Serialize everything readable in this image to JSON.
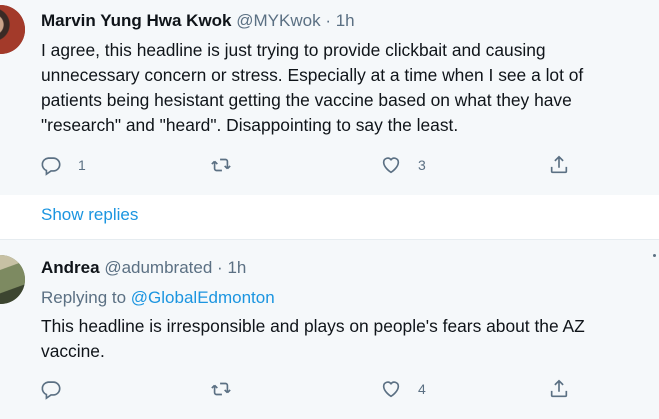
{
  "tweets": [
    {
      "name": "Marvin Yung Hwa Kwok",
      "handle": "@MYKwok",
      "dot": "·",
      "time": "1h",
      "text": "I agree, this headline is just trying to provide clickbait and causing unnecessary concern or stress. Especially at a time when I see a lot of patients being hesistant getting the vaccine based on what they have \"research\" and \"heard\". Disappointing to say the least.",
      "reply_count": "1",
      "retweet_count": "",
      "like_count": "3"
    },
    {
      "name": "Andrea",
      "handle": "@adumbrated",
      "dot": "·",
      "time": "1h",
      "replying_prefix": "Replying to",
      "replying_to": "@GlobalEdmonton",
      "text": "This headline is irresponsible and plays on people's fears about the AZ vaccine.",
      "reply_count": "",
      "retweet_count": "",
      "like_count": "4"
    }
  ],
  "show_replies_label": "Show replies",
  "colors": {
    "link": "#1b95e0",
    "secondary_text": "#5b7083",
    "tweet_background": "#f5f8fa"
  },
  "icons": [
    "reply-icon",
    "retweet-icon",
    "like-icon",
    "share-icon",
    "more-icon"
  ]
}
